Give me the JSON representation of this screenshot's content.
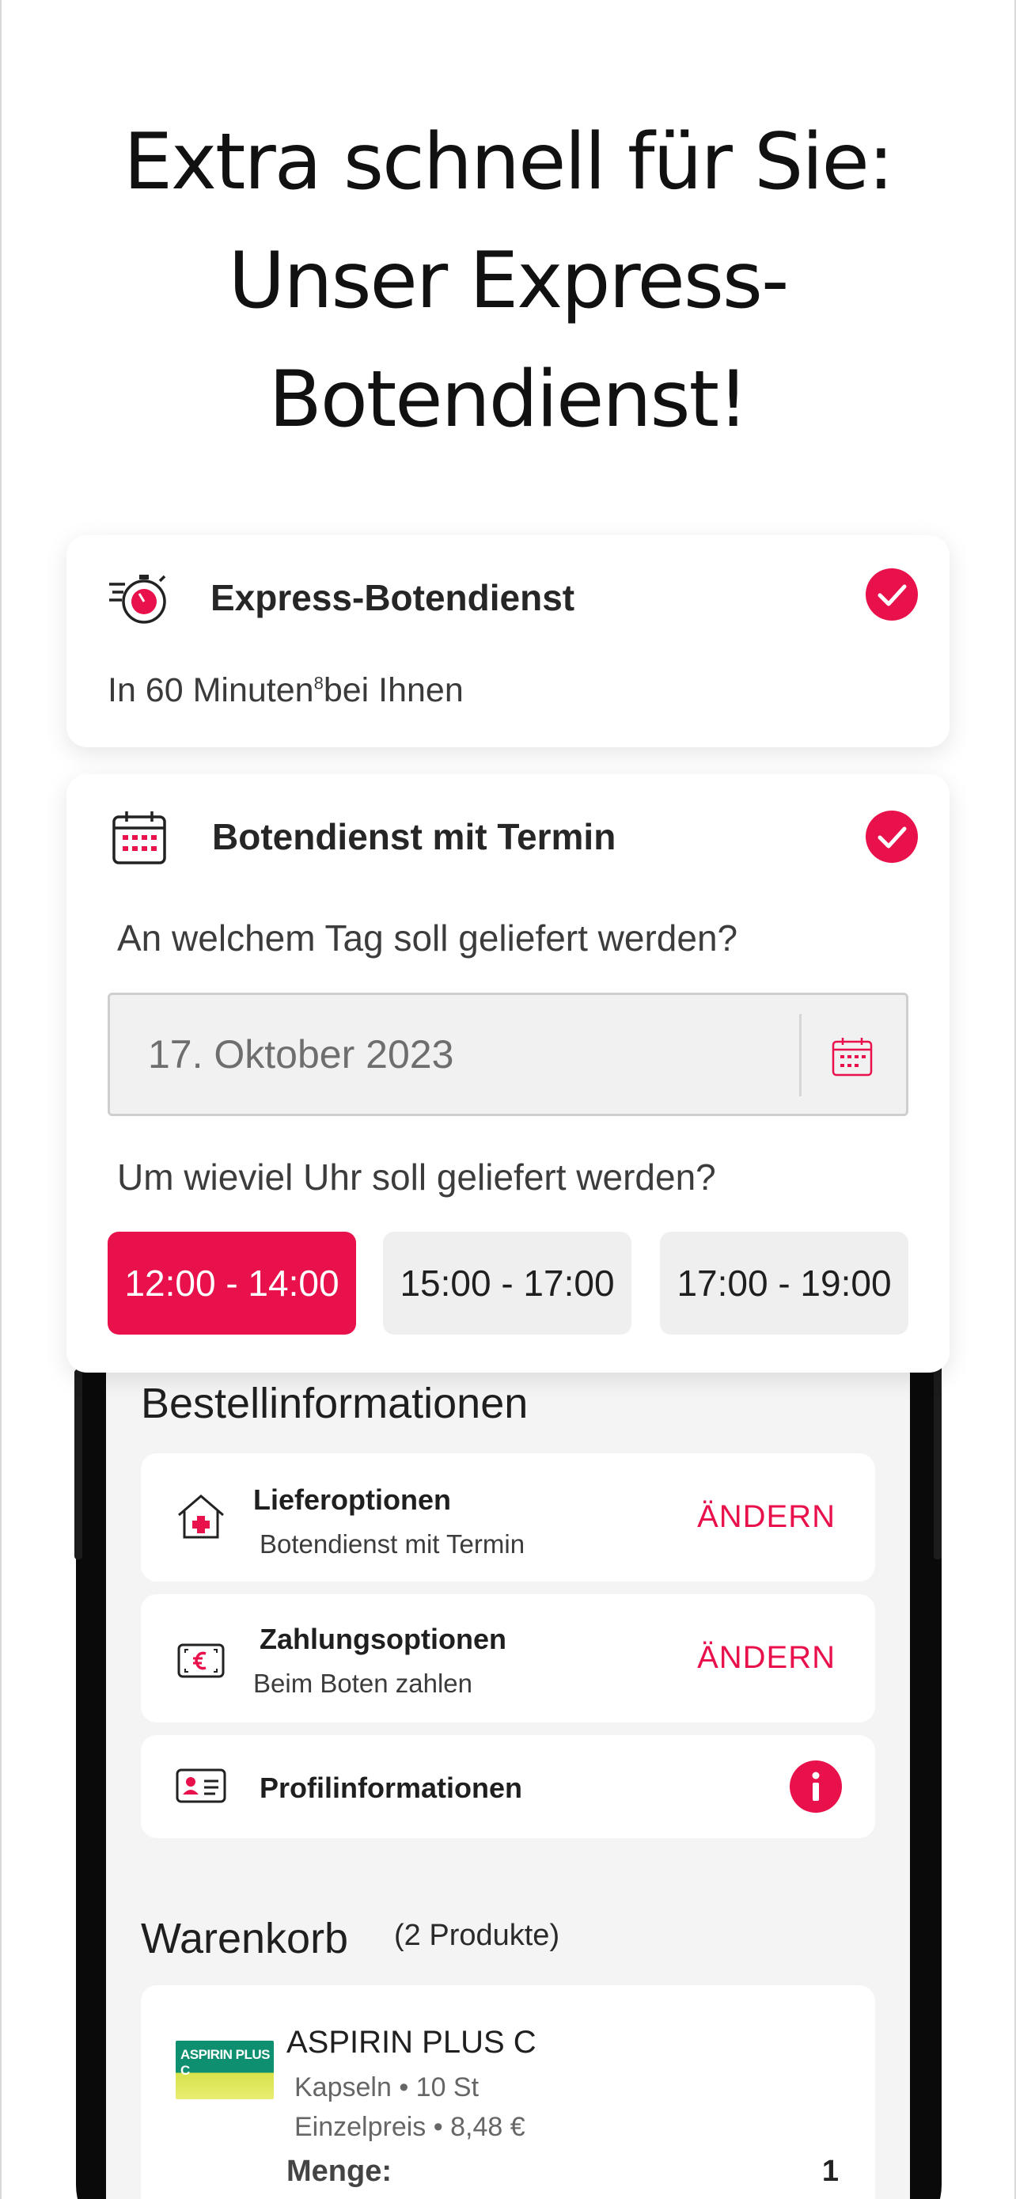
{
  "headline": {
    "line1": "Extra schnell für Sie:",
    "line2": "Unser Express-",
    "line3": "Botendienst!"
  },
  "express": {
    "title": "Express-Botendienst",
    "subtitle_pre": "In 60 Minuten",
    "subtitle_sup": "8",
    "subtitle_post": "bei Ihnen",
    "icon": "stopwatch-icon",
    "selected": true
  },
  "termin": {
    "title": "Botendienst mit Termin",
    "icon": "calendar-icon",
    "selected": true,
    "day_question": "An welchem Tag soll geliefert werden?",
    "date_value": "17. Oktober 2023",
    "time_question": "Um wieviel Uhr soll geliefert werden?",
    "slots": [
      {
        "label": "12:00 - 14:00",
        "active": true
      },
      {
        "label": "15:00 - 17:00",
        "active": false
      },
      {
        "label": "17:00 - 19:00",
        "active": false
      }
    ]
  },
  "order": {
    "title": "Bestellinformationen",
    "delivery": {
      "title": "Lieferoptionen",
      "value": "Botendienst mit Termin",
      "action": "ÄNDERN",
      "icon": "house-plus-icon"
    },
    "payment": {
      "title": "Zahlungsoptionen",
      "value": "Beim Boten zahlen",
      "action": "ÄNDERN",
      "icon": "euro-note-icon"
    },
    "profile": {
      "title": "Profilinformationen",
      "icon": "id-card-icon",
      "action_icon": "info-icon"
    }
  },
  "cart": {
    "title": "Warenkorb",
    "count": "(2 Produkte)",
    "product": {
      "name": "ASPIRIN PLUS C",
      "logo_text": "ASPIRIN PLUS C",
      "form": "Kapseln • 10 St",
      "price": "Einzelpreis • 8,48 €",
      "qty_label": "Menge:",
      "qty": "1"
    }
  },
  "colors": {
    "accent": "#e8114b",
    "screen_bg": "#f4f4f4"
  }
}
